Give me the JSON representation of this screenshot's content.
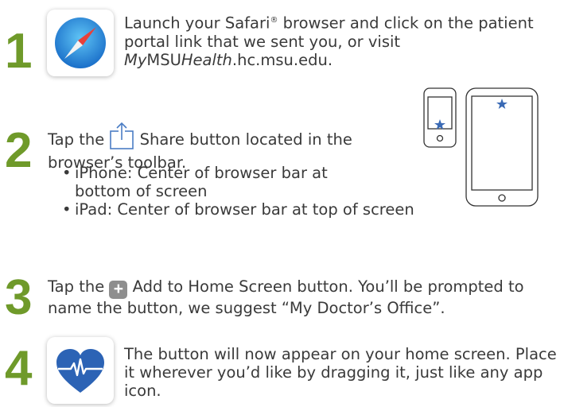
{
  "colors": {
    "step_number": "#6f9a2a",
    "safari_blue": "#1e88d4",
    "heart_blue": "#2c63b5",
    "star_blue": "#3a6ab5"
  },
  "steps": [
    {
      "number": "1",
      "icon": "safari-compass-icon",
      "text": {
        "part1": "Launch your Safari",
        "reg": "®",
        "part2": " browser and click on the patient portal link that we sent you, or visit ",
        "url_a": "My",
        "url_b": "MSU",
        "url_c": "Health",
        "url_d": ".hc.msu.edu."
      }
    },
    {
      "number": "2",
      "icon": "share-icon",
      "text": {
        "before": "Tap the",
        "after": " Share button located in the browser’s toolbar.",
        "bullet1": "iPhone: Center of browser bar at bottom of screen",
        "bullet2": "iPad: Center of browser bar at top of screen"
      },
      "devices": [
        "iphone-outline-icon",
        "ipad-outline-icon"
      ]
    },
    {
      "number": "3",
      "icon": "plus-button-icon",
      "text": {
        "before": "Tap the",
        "plus": "+",
        "after": " Add to Home Screen button. You’ll be prompted to name the button, we suggest “My Doctor’s Office”."
      }
    },
    {
      "number": "4",
      "icon": "heart-pulse-icon",
      "text": {
        "body": "The button will now appear on your home screen. Place it wherever you’d like by dragging it, just like any app icon."
      }
    }
  ]
}
